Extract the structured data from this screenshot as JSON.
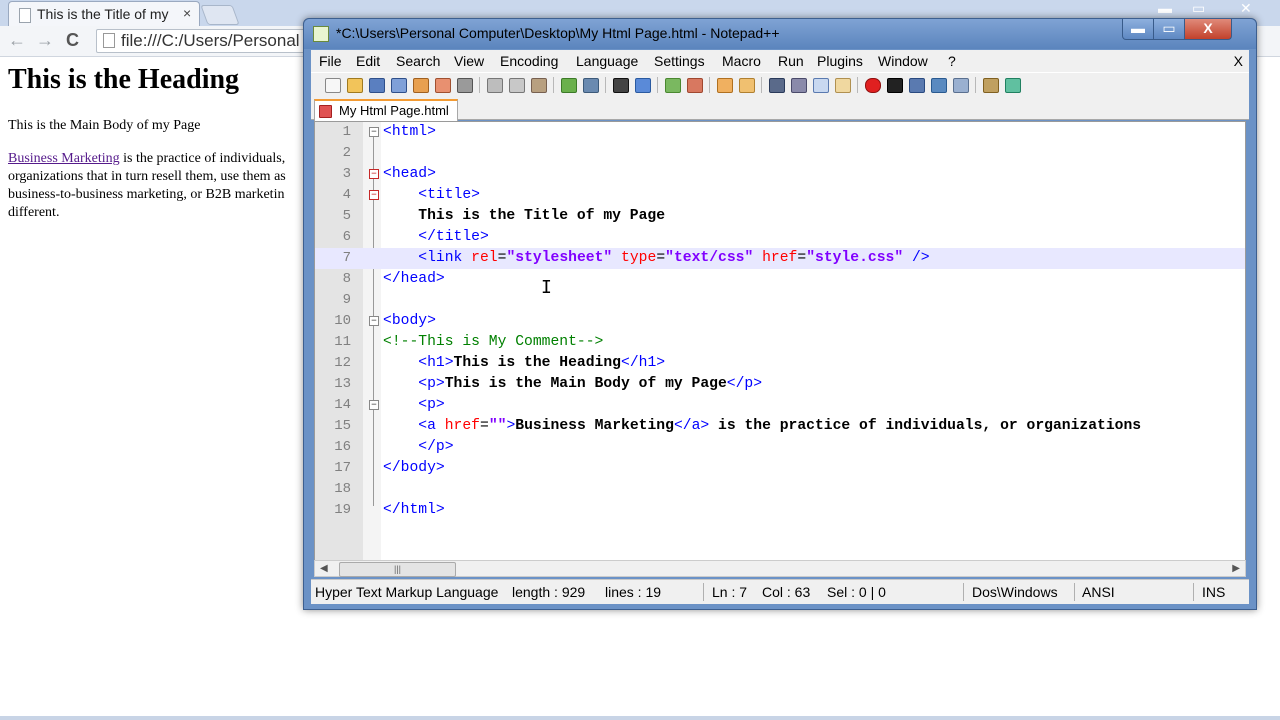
{
  "browser": {
    "tab_title": "This is the Title of my",
    "tab_close": "×",
    "url": "file:///C:/Users/Personal",
    "back": "←",
    "forward": "→",
    "reload": "C",
    "heading": "This is the Heading",
    "body_text": "This is the Main Body of my Page",
    "link_text": "Business Marketing",
    "para_line1": " is the practice of individuals,",
    "para_line2": "organizations that in turn resell them, use them as",
    "para_line3": "business-to-business marketing, or B2B marketin",
    "para_line4": "different."
  },
  "notepad": {
    "title": "*C:\\Users\\Personal Computer\\Desktop\\My Html Page.html - Notepad++",
    "window_buttons": {
      "minimize": "▬",
      "maximize": "▭",
      "close": "X"
    },
    "menu": [
      "File",
      "Edit",
      "Search",
      "View",
      "Encoding",
      "Language",
      "Settings",
      "Macro",
      "Run",
      "Plugins",
      "Window",
      "?"
    ],
    "menu_close": "X",
    "doc_tab": "My Html Page.html",
    "line_numbers": [
      "1",
      "2",
      "3",
      "4",
      "5",
      "6",
      "7",
      "8",
      "9",
      "10",
      "11",
      "12",
      "13",
      "14",
      "15",
      "16",
      "17",
      "18",
      "19"
    ],
    "status": {
      "language": "Hyper Text Markup Language",
      "length": "length : 929",
      "lines": "lines : 19",
      "ln": "Ln : 7",
      "col": "Col : 63",
      "sel": "Sel : 0 | 0",
      "eol": "Dos\\Windows",
      "encoding": "ANSI",
      "mode": "INS"
    },
    "code": {
      "l1_tag": "<html>",
      "l3_tag": "<head>",
      "l4_tag": "<title>",
      "l5_text": "This is the Title of my Page",
      "l6_tag": "</title>",
      "l7_open": "<link ",
      "l7_attr1": "rel",
      "l7_val1": "\"stylesheet\"",
      "l7_attr2": "type",
      "l7_val2": "\"text/css\"",
      "l7_attr3": "href",
      "l7_val3": "\"style.css\"",
      "l7_close": " />",
      "l8_tag": "</head>",
      "l10_tag": "<body>",
      "l11_comment": "<!--This is My Comment-->",
      "l12_open": "<h1>",
      "l12_text": "This is the Heading",
      "l12_close": "</h1>",
      "l13_open": "<p>",
      "l13_text": "This is the Main Body of my Page",
      "l13_close": "</p>",
      "l14_tag": "<p>",
      "l15_open": "<a ",
      "l15_attr": "href",
      "l15_val": "\"\"",
      "l15_gt": ">",
      "l15_text": "Business Marketing",
      "l15_close": "</a>",
      "l15_rest": " is the practice of individuals, or organizations",
      "l16_tag": "</p>",
      "l17_tag": "</body>",
      "l19_tag": "</html>",
      "eq": "="
    },
    "scroll_left": "◀",
    "scroll_right": "▶",
    "scroll_grip": "|||"
  },
  "colors": {
    "tag": "#0000ff",
    "attribute": "#ff0000",
    "value": "#8000ff",
    "comment": "#008000",
    "current_line": "#e8e8ff"
  }
}
